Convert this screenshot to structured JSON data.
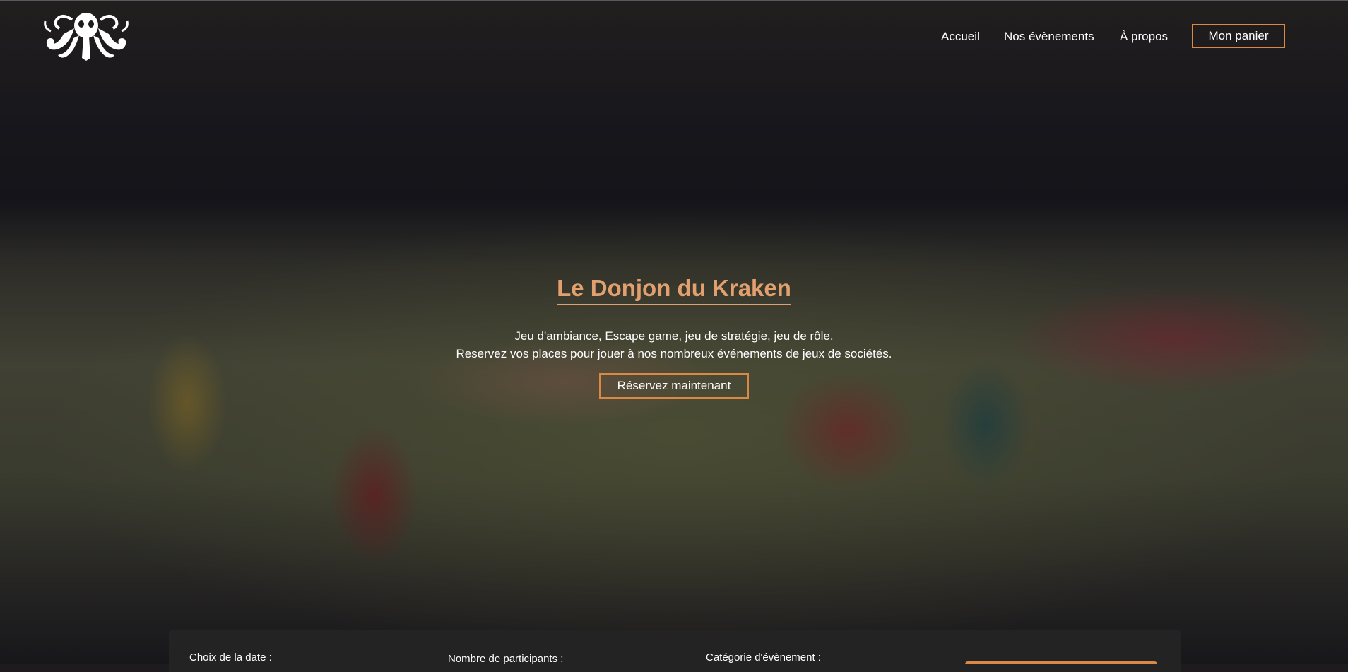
{
  "header": {
    "logo_icon": "kraken-logo-icon",
    "nav": [
      {
        "label": "Accueil"
      },
      {
        "label": "Nos évènements"
      },
      {
        "label": "À propos"
      }
    ],
    "cart_label": "Mon panier",
    "accent_color": "#d98944"
  },
  "hero": {
    "title": "Le Donjon du Kraken",
    "line1": "Jeu d'ambiance, Escape game, jeu de stratégie, jeu de rôle.",
    "line2": "Reservez vos places pour jouer à nos nombreux événements de jeux de sociétés.",
    "cta_label": "Réservez maintenant",
    "title_color": "#e3a06f"
  },
  "booking": {
    "date_label": "Choix de la date :",
    "participants_label": "Nombre de participants :",
    "category_label": "Catégorie d'évènement :"
  }
}
